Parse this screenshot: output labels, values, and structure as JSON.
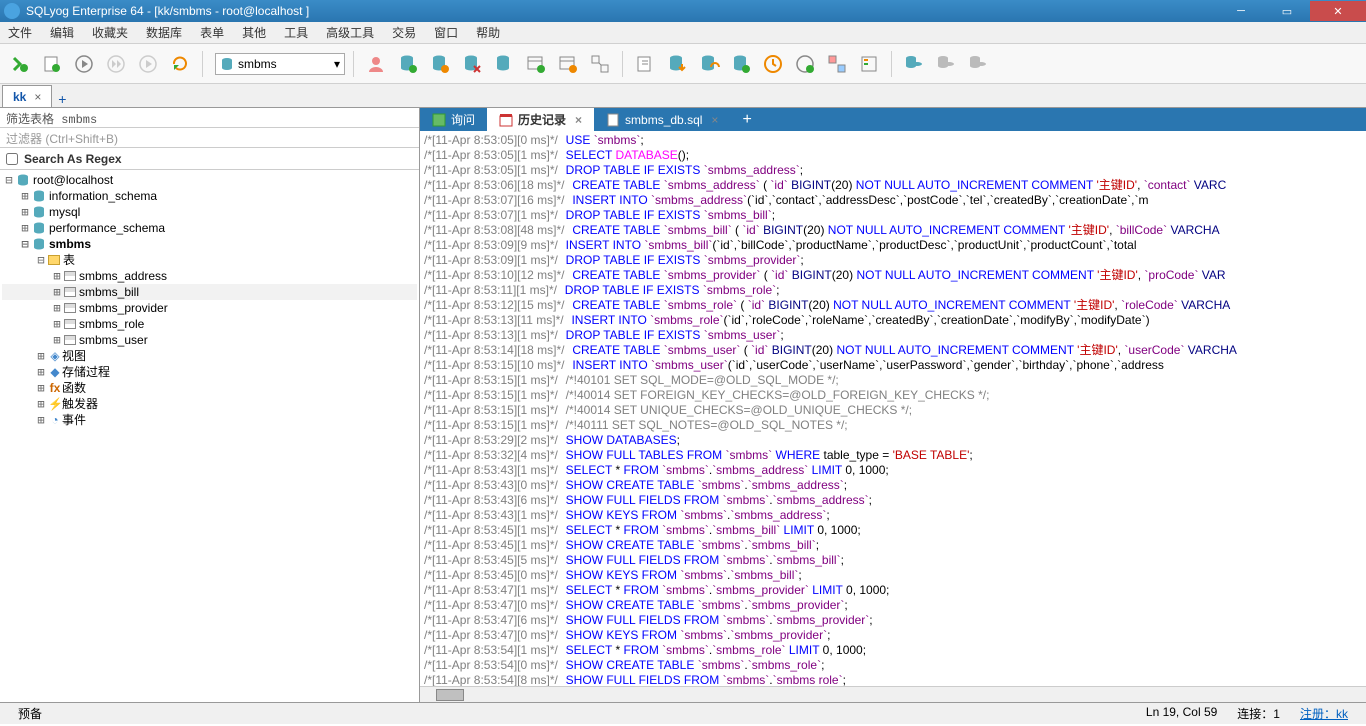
{
  "title": "SQLyog Enterprise 64 - [kk/smbms - root@localhost ]",
  "menu": [
    "文件",
    "编辑",
    "收藏夹",
    "数据库",
    "表单",
    "其他",
    "工具",
    "高级工具",
    "交易",
    "窗口",
    "帮助"
  ],
  "dbselect": "smbms",
  "conntab": "kk",
  "filter_label": "筛选表格 smbms",
  "filter_ph": "过滤器 (Ctrl+Shift+B)",
  "regex_label": "Search As Regex",
  "tree": {
    "root": "root@localhost",
    "dbs": [
      "information_schema",
      "mysql",
      "performance_schema"
    ],
    "active": "smbms",
    "tables_label": "表",
    "tables": [
      "smbms_address",
      "smbms_bill",
      "smbms_provider",
      "smbms_role",
      "smbms_user"
    ],
    "selected": "smbms_bill",
    "folders": [
      "视图",
      "存储过程",
      "函数",
      "触发器",
      "事件"
    ]
  },
  "qtabs": [
    {
      "label": "询问"
    },
    {
      "label": "历史记录",
      "active": true
    },
    {
      "label": "smbms_db.sql"
    }
  ],
  "history": [
    {
      "ts": "[11-Apr 8:53:05][0 ms]*/",
      "sql": [
        [
          "USE ",
          "kw"
        ],
        [
          "`smbms`",
          "bt"
        ],
        [
          ";",
          "p"
        ]
      ]
    },
    {
      "ts": "[11-Apr 8:53:05][1 ms]*/",
      "sql": [
        [
          "SELECT ",
          "kw"
        ],
        [
          "DATABASE",
          "fn"
        ],
        [
          "();",
          "p"
        ]
      ]
    },
    {
      "ts": "[11-Apr 8:53:05][1 ms]*/",
      "sql": [
        [
          "DROP TABLE IF EXISTS ",
          "kw"
        ],
        [
          "`smbms_address`",
          "bt"
        ],
        [
          ";",
          "p"
        ]
      ]
    },
    {
      "ts": "[11-Apr 8:53:06][18 ms]*/",
      "sql": [
        [
          "CREATE TABLE ",
          "kw"
        ],
        [
          "`smbms_address`",
          "bt"
        ],
        [
          " ( ",
          "p"
        ],
        [
          "`id`",
          "bt"
        ],
        [
          " ",
          "p"
        ],
        [
          "BIGINT",
          "ty"
        ],
        [
          "(20) ",
          "p"
        ],
        [
          "NOT NULL AUTO_INCREMENT COMMENT ",
          "kw"
        ],
        [
          "'主键ID'",
          "str"
        ],
        [
          ", ",
          "p"
        ],
        [
          "`contact`",
          "bt"
        ],
        [
          " ",
          "p"
        ],
        [
          "VARC",
          "ty"
        ]
      ]
    },
    {
      "ts": "[11-Apr 8:53:07][16 ms]*/",
      "sql": [
        [
          "INSERT INTO ",
          "kw"
        ],
        [
          "`smbms_address`",
          "bt"
        ],
        [
          "(`id`,`contact`,`addressDesc`,`postCode`,`tel`,`createdBy`,`creationDate`,`m",
          "p"
        ]
      ]
    },
    {
      "ts": "[11-Apr 8:53:07][1 ms]*/",
      "sql": [
        [
          "DROP TABLE IF EXISTS ",
          "kw"
        ],
        [
          "`smbms_bill`",
          "bt"
        ],
        [
          ";",
          "p"
        ]
      ]
    },
    {
      "ts": "[11-Apr 8:53:08][48 ms]*/",
      "sql": [
        [
          "CREATE TABLE ",
          "kw"
        ],
        [
          "`smbms_bill`",
          "bt"
        ],
        [
          " ( ",
          "p"
        ],
        [
          "`id`",
          "bt"
        ],
        [
          " ",
          "p"
        ],
        [
          "BIGINT",
          "ty"
        ],
        [
          "(20) ",
          "p"
        ],
        [
          "NOT NULL AUTO_INCREMENT COMMENT ",
          "kw"
        ],
        [
          "'主键ID'",
          "str"
        ],
        [
          ", ",
          "p"
        ],
        [
          "`billCode`",
          "bt"
        ],
        [
          " ",
          "p"
        ],
        [
          "VARCHA",
          "ty"
        ]
      ]
    },
    {
      "ts": "[11-Apr 8:53:09][9 ms]*/",
      "sql": [
        [
          "INSERT INTO ",
          "kw"
        ],
        [
          "`smbms_bill`",
          "bt"
        ],
        [
          "(`id`,`billCode`,`productName`,`productDesc`,`productUnit`,`productCount`,`total",
          "p"
        ]
      ]
    },
    {
      "ts": "[11-Apr 8:53:09][1 ms]*/",
      "sql": [
        [
          "DROP TABLE IF EXISTS ",
          "kw"
        ],
        [
          "`smbms_provider`",
          "bt"
        ],
        [
          ";",
          "p"
        ]
      ]
    },
    {
      "ts": "[11-Apr 8:53:10][12 ms]*/",
      "sql": [
        [
          "CREATE TABLE ",
          "kw"
        ],
        [
          "`smbms_provider`",
          "bt"
        ],
        [
          " ( ",
          "p"
        ],
        [
          "`id`",
          "bt"
        ],
        [
          " ",
          "p"
        ],
        [
          "BIGINT",
          "ty"
        ],
        [
          "(20) ",
          "p"
        ],
        [
          "NOT NULL AUTO_INCREMENT COMMENT ",
          "kw"
        ],
        [
          "'主键ID'",
          "str"
        ],
        [
          ", ",
          "p"
        ],
        [
          "`proCode`",
          "bt"
        ],
        [
          " ",
          "p"
        ],
        [
          "VAR",
          "ty"
        ]
      ]
    },
    {
      "ts": "[11-Apr 8:53:11][1 ms]*/",
      "sql": [
        [
          "DROP TABLE IF EXISTS ",
          "kw"
        ],
        [
          "`smbms_role`",
          "bt"
        ],
        [
          ";",
          "p"
        ]
      ]
    },
    {
      "ts": "[11-Apr 8:53:12][15 ms]*/",
      "sql": [
        [
          "CREATE TABLE ",
          "kw"
        ],
        [
          "`smbms_role`",
          "bt"
        ],
        [
          " ( ",
          "p"
        ],
        [
          "`id`",
          "bt"
        ],
        [
          " ",
          "p"
        ],
        [
          "BIGINT",
          "ty"
        ],
        [
          "(20) ",
          "p"
        ],
        [
          "NOT NULL AUTO_INCREMENT COMMENT ",
          "kw"
        ],
        [
          "'主键ID'",
          "str"
        ],
        [
          ", ",
          "p"
        ],
        [
          "`roleCode`",
          "bt"
        ],
        [
          " ",
          "p"
        ],
        [
          "VARCHA",
          "ty"
        ]
      ]
    },
    {
      "ts": "[11-Apr 8:53:13][11 ms]*/",
      "sql": [
        [
          "INSERT INTO ",
          "kw"
        ],
        [
          "`smbms_role`",
          "bt"
        ],
        [
          "(`id`,`roleCode`,`roleName`,`createdBy`,`creationDate`,`modifyBy`,`modifyDate`)",
          "p"
        ]
      ]
    },
    {
      "ts": "[11-Apr 8:53:13][1 ms]*/",
      "sql": [
        [
          "DROP TABLE IF EXISTS ",
          "kw"
        ],
        [
          "`smbms_user`",
          "bt"
        ],
        [
          ";",
          "p"
        ]
      ]
    },
    {
      "ts": "[11-Apr 8:53:14][18 ms]*/",
      "sql": [
        [
          "CREATE TABLE ",
          "kw"
        ],
        [
          "`smbms_user`",
          "bt"
        ],
        [
          " ( ",
          "p"
        ],
        [
          "`id`",
          "bt"
        ],
        [
          " ",
          "p"
        ],
        [
          "BIGINT",
          "ty"
        ],
        [
          "(20) ",
          "p"
        ],
        [
          "NOT NULL AUTO_INCREMENT COMMENT ",
          "kw"
        ],
        [
          "'主键ID'",
          "str"
        ],
        [
          ", ",
          "p"
        ],
        [
          "`userCode`",
          "bt"
        ],
        [
          " ",
          "p"
        ],
        [
          "VARCHA",
          "ty"
        ]
      ]
    },
    {
      "ts": "[11-Apr 8:53:15][10 ms]*/",
      "sql": [
        [
          "INSERT INTO ",
          "kw"
        ],
        [
          "`smbms_user`",
          "bt"
        ],
        [
          "(`id`,`userCode`,`userName`,`userPassword`,`gender`,`birthday`,`phone`,`address",
          "p"
        ]
      ]
    },
    {
      "ts": "[11-Apr 8:53:15][1 ms]*/",
      "sql": [
        [
          "/*!40101 SET SQL_MODE=@OLD_SQL_MODE */;",
          "gr"
        ]
      ]
    },
    {
      "ts": "[11-Apr 8:53:15][1 ms]*/",
      "sql": [
        [
          "/*!40014 SET FOREIGN_KEY_CHECKS=@OLD_FOREIGN_KEY_CHECKS */;",
          "gr"
        ]
      ]
    },
    {
      "ts": "[11-Apr 8:53:15][1 ms]*/",
      "sql": [
        [
          "/*!40014 SET UNIQUE_CHECKS=@OLD_UNIQUE_CHECKS */;",
          "gr"
        ]
      ]
    },
    {
      "ts": "[11-Apr 8:53:15][1 ms]*/",
      "sql": [
        [
          "/*!40111 SET SQL_NOTES=@OLD_SQL_NOTES */;",
          "gr"
        ]
      ]
    },
    {
      "ts": "[11-Apr 8:53:29][2 ms]*/",
      "sql": [
        [
          "SHOW DATABASES",
          "kw"
        ],
        [
          ";",
          "p"
        ]
      ]
    },
    {
      "ts": "[11-Apr 8:53:32][4 ms]*/",
      "sql": [
        [
          "SHOW FULL TABLES FROM ",
          "kw"
        ],
        [
          "`smbms`",
          "bt"
        ],
        [
          " ",
          "p"
        ],
        [
          "WHERE ",
          "kw"
        ],
        [
          "table_type = ",
          "p"
        ],
        [
          "'BASE TABLE'",
          "str"
        ],
        [
          ";",
          "p"
        ]
      ]
    },
    {
      "ts": "[11-Apr 8:53:43][1 ms]*/",
      "sql": [
        [
          "SELECT ",
          "kw"
        ],
        [
          "* ",
          "p"
        ],
        [
          "FROM ",
          "kw"
        ],
        [
          "`smbms`",
          "bt"
        ],
        [
          ".",
          "p"
        ],
        [
          "`smbms_address`",
          "bt"
        ],
        [
          " ",
          "p"
        ],
        [
          "LIMIT ",
          "kw"
        ],
        [
          "0, 1000;",
          "p"
        ]
      ]
    },
    {
      "ts": "[11-Apr 8:53:43][0 ms]*/",
      "sql": [
        [
          "SHOW CREATE TABLE ",
          "kw"
        ],
        [
          "`smbms`",
          "bt"
        ],
        [
          ".",
          "p"
        ],
        [
          "`smbms_address`",
          "bt"
        ],
        [
          ";",
          "p"
        ]
      ]
    },
    {
      "ts": "[11-Apr 8:53:43][6 ms]*/",
      "sql": [
        [
          "SHOW FULL FIELDS FROM ",
          "kw"
        ],
        [
          "`smbms`",
          "bt"
        ],
        [
          ".",
          "p"
        ],
        [
          "`smbms_address`",
          "bt"
        ],
        [
          ";",
          "p"
        ]
      ]
    },
    {
      "ts": "[11-Apr 8:53:43][1 ms]*/",
      "sql": [
        [
          "SHOW KEYS FROM ",
          "kw"
        ],
        [
          "`smbms`",
          "bt"
        ],
        [
          ".",
          "p"
        ],
        [
          "`smbms_address`",
          "bt"
        ],
        [
          ";",
          "p"
        ]
      ]
    },
    {
      "ts": "[11-Apr 8:53:45][1 ms]*/",
      "sql": [
        [
          "SELECT ",
          "kw"
        ],
        [
          "* ",
          "p"
        ],
        [
          "FROM ",
          "kw"
        ],
        [
          "`smbms`",
          "bt"
        ],
        [
          ".",
          "p"
        ],
        [
          "`smbms_bill`",
          "bt"
        ],
        [
          " ",
          "p"
        ],
        [
          "LIMIT ",
          "kw"
        ],
        [
          "0, 1000;",
          "p"
        ]
      ]
    },
    {
      "ts": "[11-Apr 8:53:45][1 ms]*/",
      "sql": [
        [
          "SHOW CREATE TABLE ",
          "kw"
        ],
        [
          "`smbms`",
          "bt"
        ],
        [
          ".",
          "p"
        ],
        [
          "`smbms_bill`",
          "bt"
        ],
        [
          ";",
          "p"
        ]
      ]
    },
    {
      "ts": "[11-Apr 8:53:45][5 ms]*/",
      "sql": [
        [
          "SHOW FULL FIELDS FROM ",
          "kw"
        ],
        [
          "`smbms`",
          "bt"
        ],
        [
          ".",
          "p"
        ],
        [
          "`smbms_bill`",
          "bt"
        ],
        [
          ";",
          "p"
        ]
      ]
    },
    {
      "ts": "[11-Apr 8:53:45][0 ms]*/",
      "sql": [
        [
          "SHOW KEYS FROM ",
          "kw"
        ],
        [
          "`smbms`",
          "bt"
        ],
        [
          ".",
          "p"
        ],
        [
          "`smbms_bill`",
          "bt"
        ],
        [
          ";",
          "p"
        ]
      ]
    },
    {
      "ts": "[11-Apr 8:53:47][1 ms]*/",
      "sql": [
        [
          "SELECT ",
          "kw"
        ],
        [
          "* ",
          "p"
        ],
        [
          "FROM ",
          "kw"
        ],
        [
          "`smbms`",
          "bt"
        ],
        [
          ".",
          "p"
        ],
        [
          "`smbms_provider`",
          "bt"
        ],
        [
          " ",
          "p"
        ],
        [
          "LIMIT ",
          "kw"
        ],
        [
          "0, 1000;",
          "p"
        ]
      ]
    },
    {
      "ts": "[11-Apr 8:53:47][0 ms]*/",
      "sql": [
        [
          "SHOW CREATE TABLE ",
          "kw"
        ],
        [
          "`smbms`",
          "bt"
        ],
        [
          ".",
          "p"
        ],
        [
          "`smbms_provider`",
          "bt"
        ],
        [
          ";",
          "p"
        ]
      ]
    },
    {
      "ts": "[11-Apr 8:53:47][6 ms]*/",
      "sql": [
        [
          "SHOW FULL FIELDS FROM ",
          "kw"
        ],
        [
          "`smbms`",
          "bt"
        ],
        [
          ".",
          "p"
        ],
        [
          "`smbms_provider`",
          "bt"
        ],
        [
          ";",
          "p"
        ]
      ]
    },
    {
      "ts": "[11-Apr 8:53:47][0 ms]*/",
      "sql": [
        [
          "SHOW KEYS FROM ",
          "kw"
        ],
        [
          "`smbms`",
          "bt"
        ],
        [
          ".",
          "p"
        ],
        [
          "`smbms_provider`",
          "bt"
        ],
        [
          ";",
          "p"
        ]
      ]
    },
    {
      "ts": "[11-Apr 8:53:54][1 ms]*/",
      "sql": [
        [
          "SELECT ",
          "kw"
        ],
        [
          "* ",
          "p"
        ],
        [
          "FROM ",
          "kw"
        ],
        [
          "`smbms`",
          "bt"
        ],
        [
          ".",
          "p"
        ],
        [
          "`smbms_role`",
          "bt"
        ],
        [
          " ",
          "p"
        ],
        [
          "LIMIT ",
          "kw"
        ],
        [
          "0, 1000;",
          "p"
        ]
      ]
    },
    {
      "ts": "[11-Apr 8:53:54][0 ms]*/",
      "sql": [
        [
          "SHOW CREATE TABLE ",
          "kw"
        ],
        [
          "`smbms`",
          "bt"
        ],
        [
          ".",
          "p"
        ],
        [
          "`smbms_role`",
          "bt"
        ],
        [
          ";",
          "p"
        ]
      ]
    },
    {
      "ts": "[11-Apr 8:53:54][8 ms]*/",
      "sql": [
        [
          "SHOW FULL FIELDS FROM ",
          "kw"
        ],
        [
          "`smbms`",
          "bt"
        ],
        [
          ".",
          "p"
        ],
        [
          "`smbms role`",
          "bt"
        ],
        [
          ";",
          "p"
        ]
      ]
    }
  ],
  "status": {
    "ready": "预备",
    "pos": "Ln 19, Col 59",
    "conn": "连接：1",
    "reg": "注册：kk"
  }
}
